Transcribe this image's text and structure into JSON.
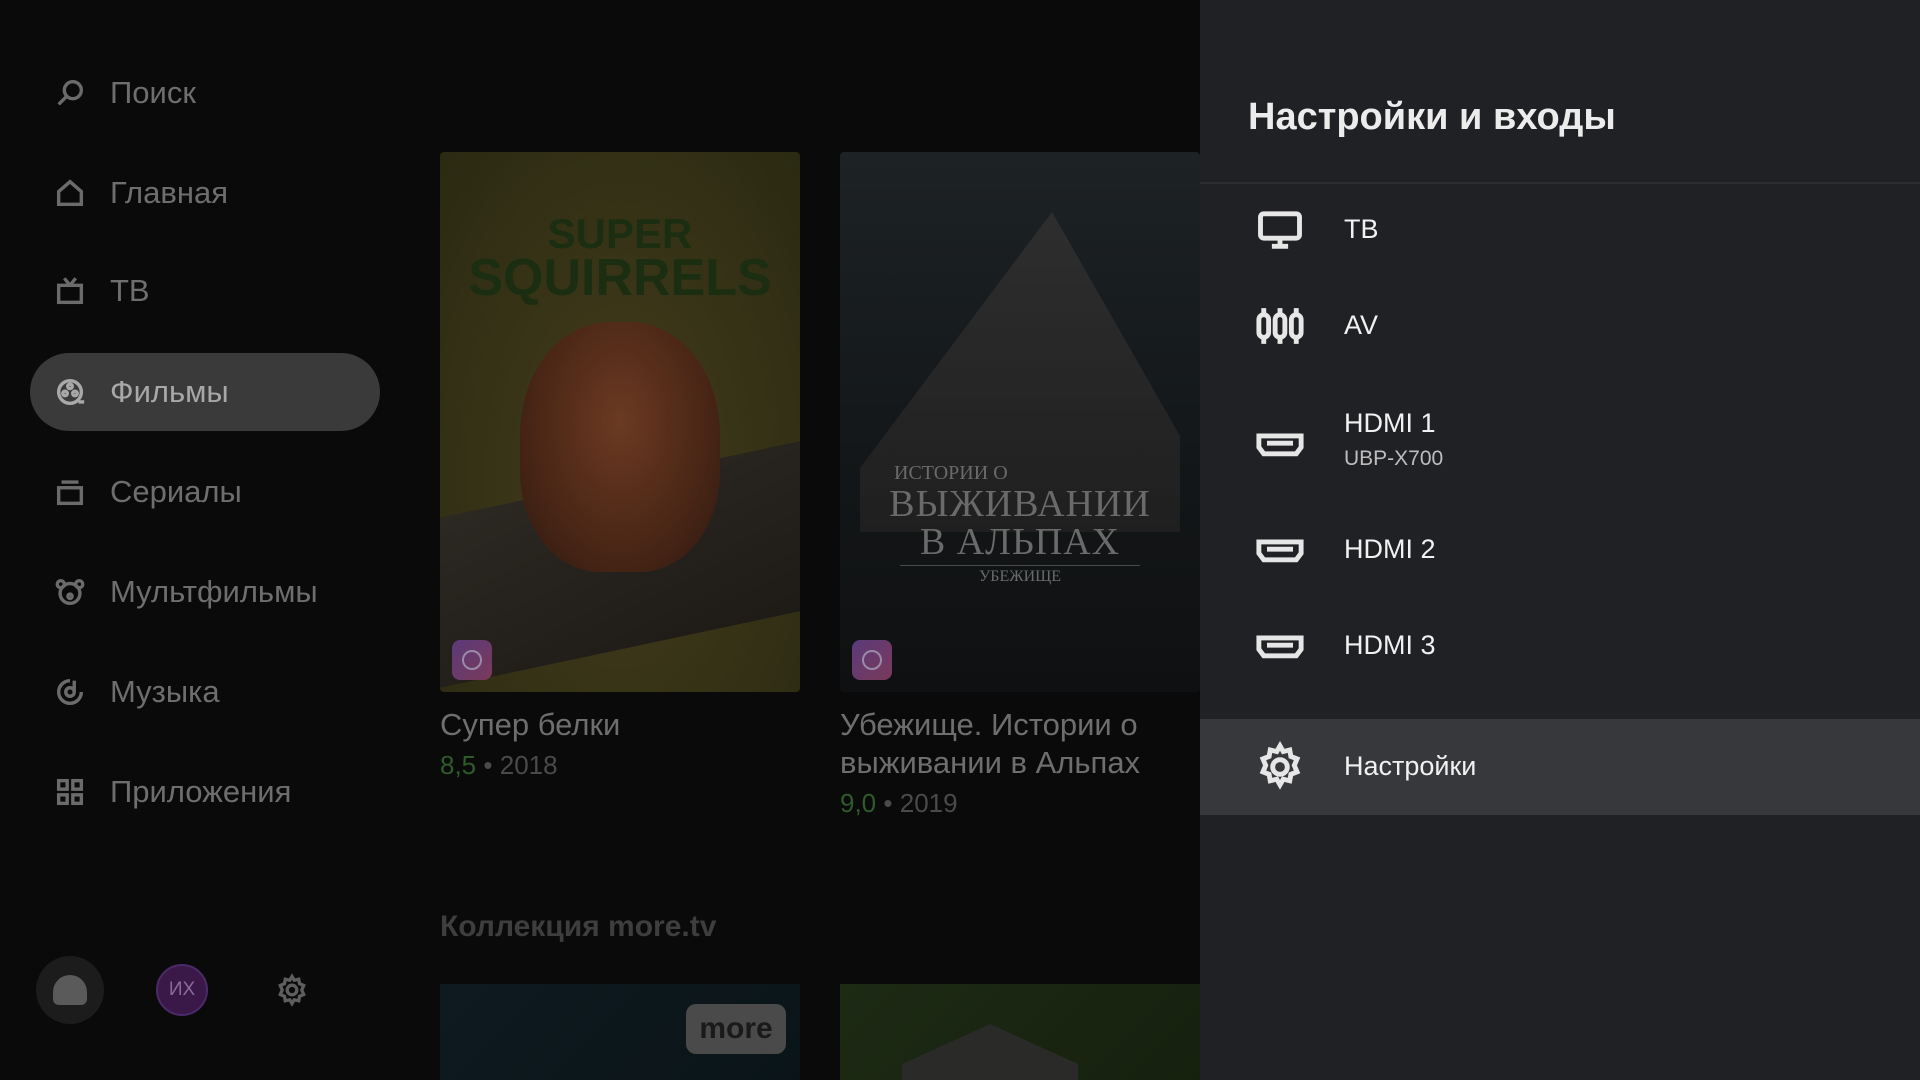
{
  "sidebar": {
    "items": [
      {
        "label": "Поиск",
        "icon": "search-icon"
      },
      {
        "label": "Главная",
        "icon": "home-icon"
      },
      {
        "label": "ТВ",
        "icon": "tv-icon"
      },
      {
        "label": "Фильмы",
        "icon": "film-reel-icon",
        "active": true
      },
      {
        "label": "Сериалы",
        "icon": "series-stack-icon"
      },
      {
        "label": "Мультфильмы",
        "icon": "bear-icon"
      },
      {
        "label": "Музыка",
        "icon": "music-icon"
      },
      {
        "label": "Приложения",
        "icon": "apps-grid-icon"
      }
    ],
    "avatar_initials": "ИХ"
  },
  "content": {
    "cards": [
      {
        "title": "Супер белки",
        "rating": "8,5",
        "year": "2018",
        "poster_line1": "SUPER",
        "poster_line2": "SQUIRRELS"
      },
      {
        "title": "Убежище. Истории о выживании в Альпах",
        "rating": "9,0",
        "year": "2019",
        "poster_line1": "ИСТОРИИ О",
        "poster_line2": "ВЫЖИВАНИИ",
        "poster_line3": "В АЛЬПАХ",
        "poster_line4": "УБЕЖИЩЕ"
      }
    ],
    "meta_separator": "•",
    "section_title": "Коллекция more.tv",
    "more_badge": "more"
  },
  "panel": {
    "title": "Настройки и входы",
    "items": [
      {
        "label": "ТВ",
        "icon": "monitor-icon"
      },
      {
        "label": "AV",
        "icon": "av-connector-icon"
      },
      {
        "label": "HDMI 1",
        "sublabel": "UBP-X700",
        "icon": "hdmi-icon"
      },
      {
        "label": "HDMI 2",
        "icon": "hdmi-icon"
      },
      {
        "label": "HDMI 3",
        "icon": "hdmi-icon"
      },
      {
        "label": "Настройки",
        "icon": "gear-icon",
        "focused": true
      }
    ]
  },
  "colors": {
    "panel_bg": "#202124",
    "focus_bg": "#37383c",
    "active_nav_bg": "#3a3a3a",
    "rating_green": "#2f5a2a"
  }
}
